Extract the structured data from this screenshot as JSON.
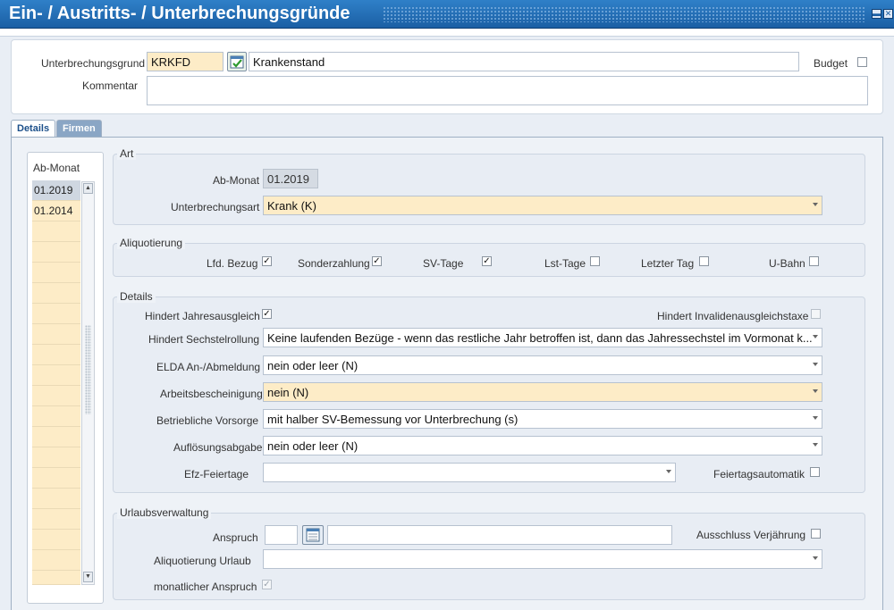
{
  "window": {
    "title": "Ein- / Austritts- / Unterbrechungsgründe"
  },
  "header": {
    "grund_label": "Unterbrechungsgrund",
    "grund_code": "KRKFD",
    "grund_name": "Krankenstand",
    "budget_label": "Budget",
    "kommentar_label": "Kommentar",
    "kommentar_value": ""
  },
  "tabs": [
    {
      "label": "Details"
    },
    {
      "label": "Firmen"
    }
  ],
  "list": {
    "header": "Ab-Monat",
    "items": [
      "01.2019",
      "01.2014"
    ]
  },
  "art": {
    "legend": "Art",
    "ab_monat_label": "Ab-Monat",
    "ab_monat_value": "01.2019",
    "unterbrechungsart_label": "Unterbrechungsart",
    "unterbrechungsart_value": "Krank (K)"
  },
  "aliquotierung": {
    "legend": "Aliquotierung",
    "items": [
      {
        "label": "Lfd. Bezug",
        "checked": true
      },
      {
        "label": "Sonderzahlung",
        "checked": true
      },
      {
        "label": "SV-Tage",
        "checked": true
      },
      {
        "label": "Lst-Tage",
        "checked": false
      },
      {
        "label": "Letzter Tag",
        "checked": false
      },
      {
        "label": "U-Bahn",
        "checked": false
      }
    ]
  },
  "details": {
    "legend": "Details",
    "jahresausgleich_label": "Hindert Jahresausgleich",
    "invaliden_label": "Hindert Invalidenausgleichstaxe",
    "sechstel_label": "Hindert Sechstelrollung",
    "sechstel_value": "Keine laufenden Bezüge - wenn das restliche Jahr betroffen ist, dann das Jahressechstel im Vormonat k...",
    "elda_label": "ELDA An-/Abmeldung",
    "elda_value": "nein oder leer (N)",
    "arbeits_label": "Arbeitsbescheinigung",
    "arbeits_value": "nein (N)",
    "vorsorge_label": "Betriebliche Vorsorge",
    "vorsorge_value": "mit halber SV-Bemessung vor Unterbrechung (s)",
    "aufloesung_label": "Auflösungsabgabe",
    "aufloesung_value": "nein oder leer (N)",
    "efz_label": "Efz-Feiertage",
    "efz_value": "",
    "feiertag_label": "Feiertagsautomatik"
  },
  "urlaub": {
    "legend": "Urlaubsverwaltung",
    "anspruch_label": "Anspruch",
    "anspruch_value": "",
    "anspruch_text": "",
    "verjaehrung_label": "Ausschluss Verjährung",
    "aliquot_label": "Aliquotierung Urlaub",
    "aliquot_value": "",
    "monatlich_label": "monatlicher Anspruch"
  },
  "colors": {
    "titlebar": "#1b5fa4",
    "highlight_field": "#fdecc7"
  }
}
